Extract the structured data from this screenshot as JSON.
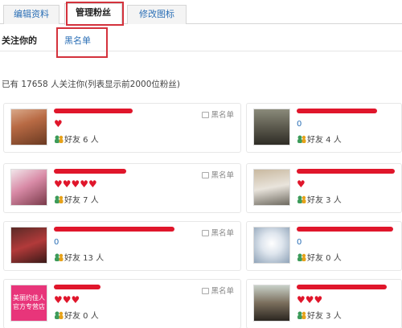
{
  "tabs": [
    {
      "label": "编辑资料"
    },
    {
      "label": "管理粉丝"
    },
    {
      "label": "修改图标"
    }
  ],
  "subnav": {
    "follow_me": "关注你的",
    "blacklist": "黑名单"
  },
  "summary": "已有 17658 人关注你(列表显示前2000位粉丝)",
  "block_label": "黑名单",
  "cards": [
    {
      "hearts": "♥",
      "friends": "好友 6 人"
    },
    {
      "zero": "0",
      "friends": "好友 4 人"
    },
    {
      "hearts": "♥♥♥♥♥",
      "friends": "好友 7 人"
    },
    {
      "hearts": "♥",
      "friends": "好友 3 人"
    },
    {
      "zero": "0",
      "friends": "好友 13 人"
    },
    {
      "zero": "0",
      "friends": "好友 0 人"
    },
    {
      "hearts": "♥♥♥",
      "friends": "好友 0 人",
      "avatar_text": "美丽约佳人\n官方专营店"
    },
    {
      "hearts": "♥♥♥",
      "friends": "好友 3 人"
    }
  ]
}
